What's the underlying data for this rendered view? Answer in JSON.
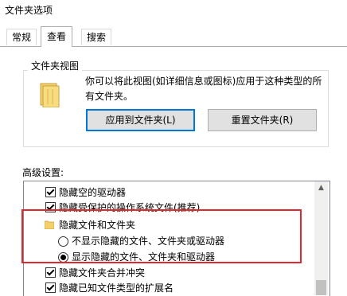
{
  "window": {
    "title": "文件夹选项"
  },
  "tabs": [
    {
      "label": "常规"
    },
    {
      "label": "查看"
    },
    {
      "label": "搜索"
    }
  ],
  "folder_views": {
    "title": "文件夹视图",
    "description": "你可以将此视图(如详细信息或图标)应用于这种类型的所有文件夹。",
    "apply_button": "应用到文件夹(L)",
    "reset_button": "重置文件夹(R)"
  },
  "advanced": {
    "label": "高级设置:",
    "items": [
      {
        "type": "checkbox",
        "checked": true,
        "label": "隐藏空的驱动器"
      },
      {
        "type": "checkbox",
        "checked": true,
        "label": "隐藏受保护的操作系统文件(推荐)"
      },
      {
        "type": "folder",
        "label": "隐藏文件和文件夹"
      },
      {
        "type": "radio",
        "selected": false,
        "label": "不显示隐藏的文件、文件夹或驱动器"
      },
      {
        "type": "radio",
        "selected": true,
        "label": "显示隐藏的文件、文件夹和驱动器"
      },
      {
        "type": "checkbox",
        "checked": true,
        "label": "隐藏文件夹合并冲突"
      },
      {
        "type": "checkbox",
        "checked": true,
        "label": "隐藏已知文件类型的扩展名"
      }
    ]
  },
  "colors": {
    "highlight_border": "#e0282e",
    "focus_button_border": "#0078d7",
    "folder_yellow": "#f4d06a"
  }
}
